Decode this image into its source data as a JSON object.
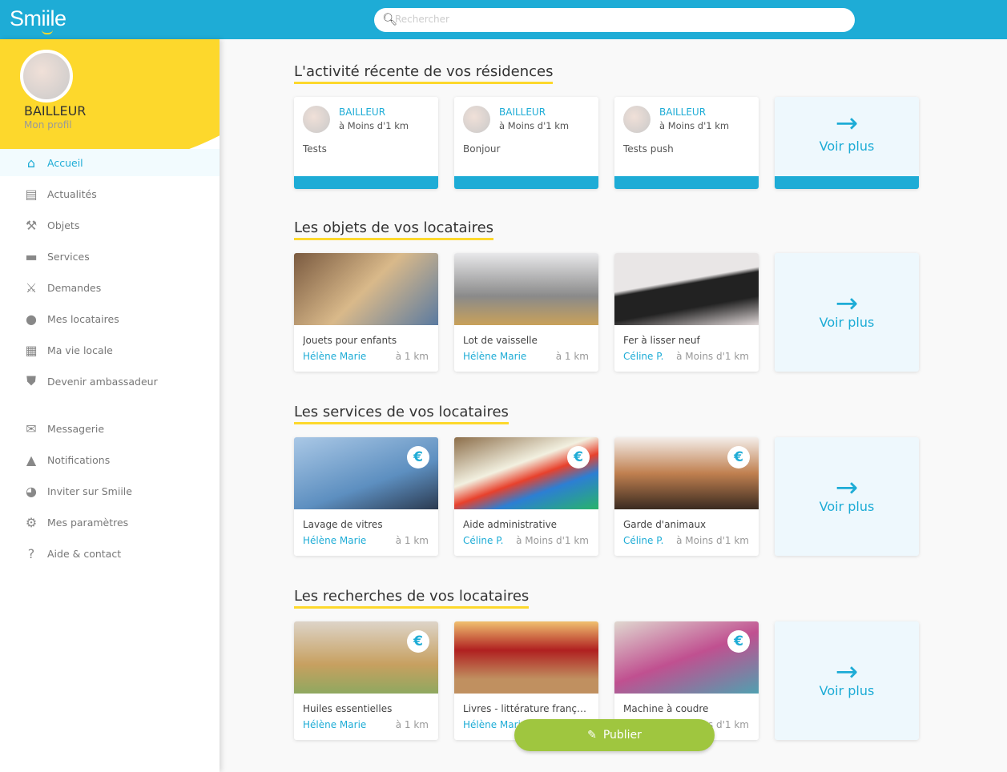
{
  "app": {
    "logo": "Smiile",
    "search_placeholder": "Rechercher"
  },
  "profile": {
    "role": "BAILLEUR",
    "link": "Mon profil"
  },
  "nav": [
    {
      "label": "Accueil",
      "icon": "home-icon",
      "active": true
    },
    {
      "label": "Actualités",
      "icon": "newspaper-icon"
    },
    {
      "label": "Objets",
      "icon": "tools-icon"
    },
    {
      "label": "Services",
      "icon": "paint-roller-icon"
    },
    {
      "label": "Demandes",
      "icon": "handshake-icon"
    },
    {
      "label": "Mes locataires",
      "icon": "users-icon"
    },
    {
      "label": "Ma vie locale",
      "icon": "store-icon"
    },
    {
      "label": "Devenir ambassadeur",
      "icon": "shield-icon"
    },
    {
      "label": "Messagerie",
      "icon": "envelope-icon"
    },
    {
      "label": "Notifications",
      "icon": "bell-icon"
    },
    {
      "label": "Inviter sur Smiile",
      "icon": "user-plus-icon"
    },
    {
      "label": "Mes paramètres",
      "icon": "gear-icon"
    },
    {
      "label": "Aide & contact",
      "icon": "question-icon"
    }
  ],
  "sections": {
    "activity": {
      "title": "L'activité récente de vos résidences",
      "more": "Voir plus",
      "cards": [
        {
          "name": "BAILLEUR",
          "distance": "à Moins d'1 km",
          "message": "Tests"
        },
        {
          "name": "BAILLEUR",
          "distance": "à Moins d'1 km",
          "message": "Bonjour"
        },
        {
          "name": "BAILLEUR",
          "distance": "à Moins d'1 km",
          "message": "Tests push"
        }
      ]
    },
    "objects": {
      "title": "Les objets de vos locataires",
      "more": "Voir plus",
      "cards": [
        {
          "title": "Jouets pour enfants",
          "seller": "Hélène Marie",
          "distance": "à 1 km",
          "paid": false
        },
        {
          "title": "Lot de vaisselle",
          "seller": "Hélène Marie",
          "distance": "à 1 km",
          "paid": false
        },
        {
          "title": "Fer à lisser neuf",
          "seller": "Céline P.",
          "distance": "à Moins d'1 km",
          "paid": false
        }
      ]
    },
    "services": {
      "title": "Les services de vos locataires",
      "more": "Voir plus",
      "cards": [
        {
          "title": "Lavage de vitres",
          "seller": "Hélène Marie",
          "distance": "à 1 km",
          "paid": true
        },
        {
          "title": "Aide administrative",
          "seller": "Céline P.",
          "distance": "à Moins d'1 km",
          "paid": true
        },
        {
          "title": "Garde d'animaux",
          "seller": "Céline P.",
          "distance": "à Moins d'1 km",
          "paid": true
        }
      ]
    },
    "searches": {
      "title": "Les recherches de vos locataires",
      "more": "Voir plus",
      "cards": [
        {
          "title": "Huiles essentielles",
          "seller": "Hélène Marie",
          "distance": "à 1 km",
          "paid": true
        },
        {
          "title": "Livres - littérature française",
          "seller": "Hélène Marie",
          "distance": "",
          "paid": false
        },
        {
          "title": "Machine à coudre",
          "seller": "",
          "distance": "à Moins d'1 km",
          "paid": true
        }
      ]
    }
  },
  "publish_label": "Publier",
  "colors": {
    "brand": "#1eacd6",
    "accent": "#fdd82c",
    "publish": "#9fc63f"
  }
}
